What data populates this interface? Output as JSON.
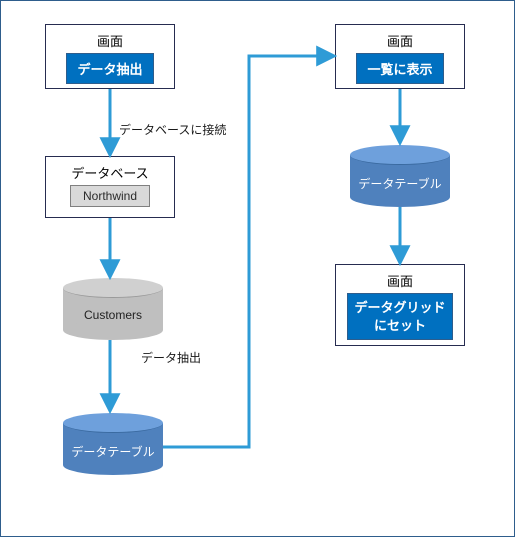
{
  "colors": {
    "border": "#2e5d8c",
    "boxBorder": "#262c50",
    "btnFill": "#0070c0",
    "arrowBlue": "#2e9bd6",
    "cylGreyTop": "#d0d0d0",
    "cylGreyMid": "#bfbfbf",
    "cylBlueTop": "#6ea0dc",
    "cylBlueMid": "#4f81bd"
  },
  "box1": {
    "title": "画面",
    "button": "データ抽出"
  },
  "label_connect": "データベースに接続",
  "box2": {
    "title": "データベース",
    "chip": "Northwind"
  },
  "cylinder_customers": {
    "label": "Customers",
    "fill": "grey"
  },
  "label_extract": "データ抽出",
  "cylinder_datatable1": {
    "label": "データテーブル",
    "fill": "blue"
  },
  "box3": {
    "title": "画面",
    "button": "一覧に表示"
  },
  "cylinder_datatable2": {
    "label": "データテーブル",
    "fill": "blue"
  },
  "box4": {
    "title": "画面",
    "button": "データグリッド\nにセット"
  }
}
